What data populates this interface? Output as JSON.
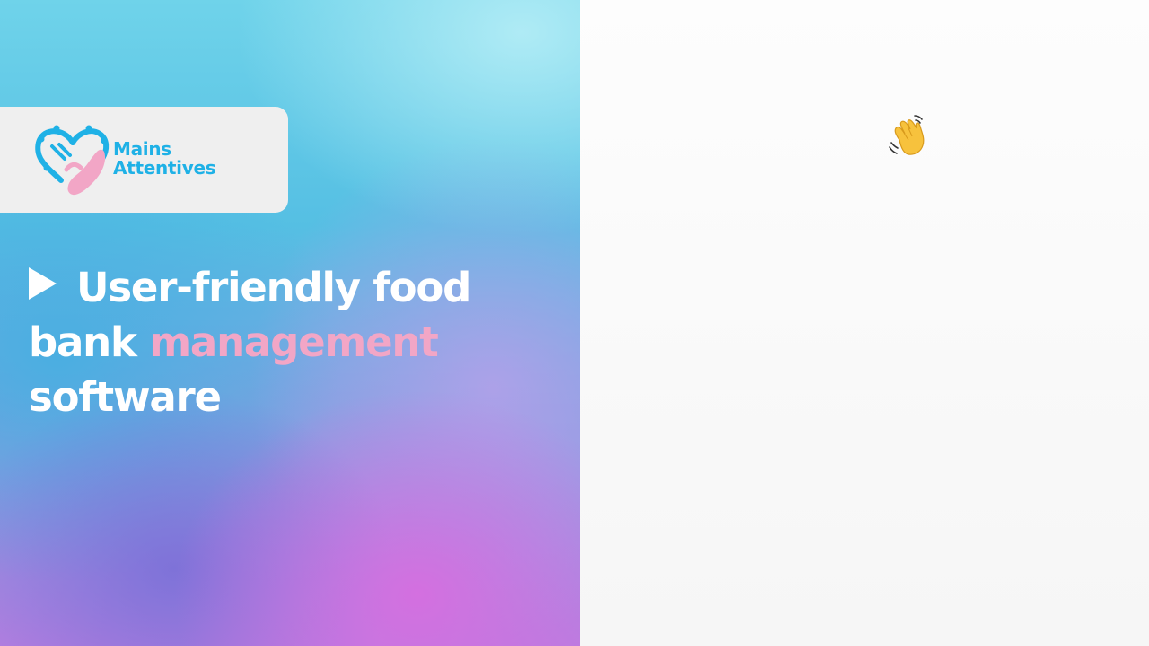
{
  "logo": {
    "line1": "Mains",
    "line2": "Attentives"
  },
  "headline": {
    "part1": "User-friendly food",
    "part2": "bank",
    "accent": "management",
    "part3": "software"
  },
  "icons": {
    "play": "play-triangle-icon",
    "wave": "waving-hand-icon"
  },
  "colors": {
    "brand_blue": "#1fb1e6",
    "accent_pink": "#f2a6c6"
  }
}
